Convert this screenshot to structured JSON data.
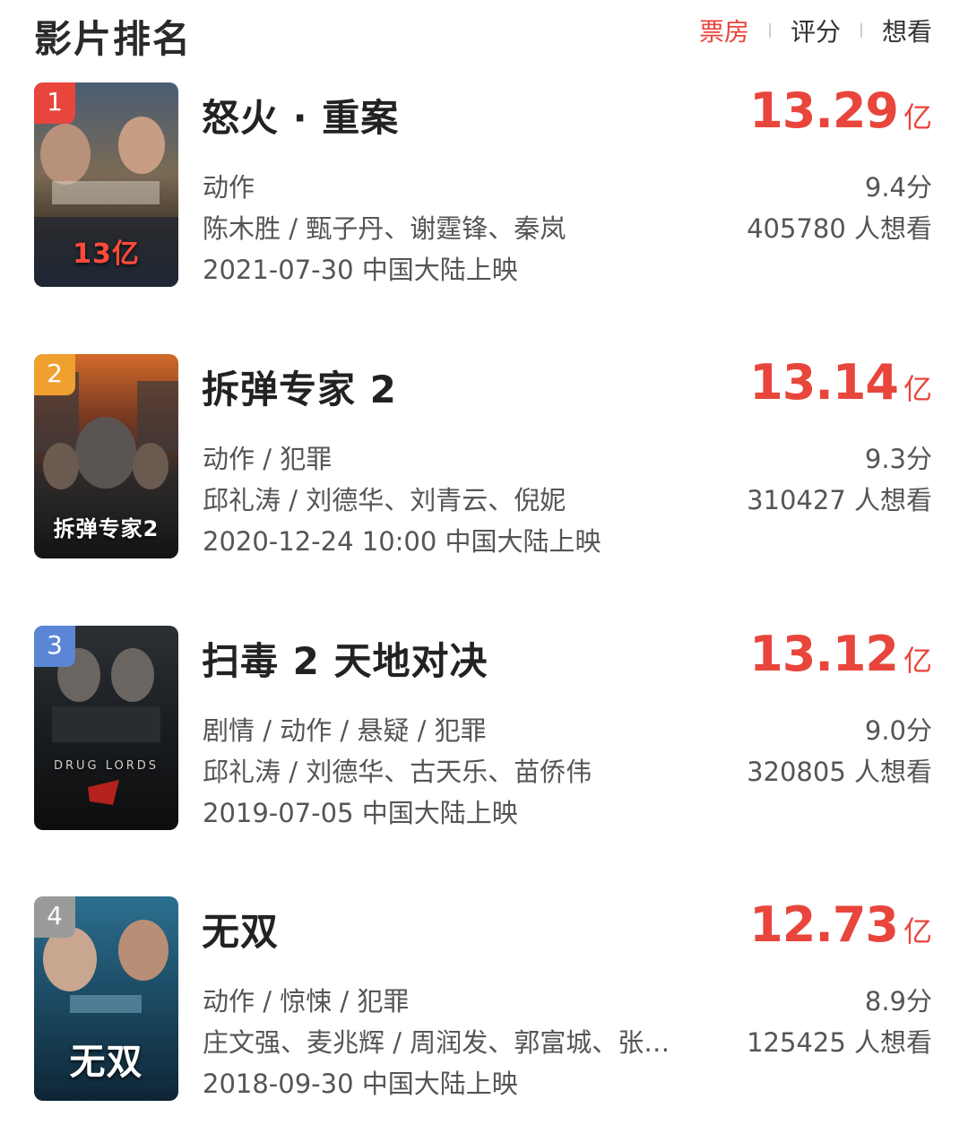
{
  "header": {
    "title": "影片排名",
    "tabs": [
      {
        "label": "票房",
        "active": true
      },
      {
        "label": "评分",
        "active": false
      },
      {
        "label": "想看",
        "active": false
      }
    ]
  },
  "colors": {
    "accent": "#e8453c",
    "rank_1": "#e8453c",
    "rank_2": "#f0a030",
    "rank_3": "#5b86d6",
    "rank_4": "#9a9a9a"
  },
  "movies": [
    {
      "rank": "1",
      "title": "怒火 · 重案",
      "boxoffice": "13.29",
      "unit": "亿",
      "genre": "动作",
      "score": "9.4分",
      "cast": "陈木胜 / 甄子丹、谢霆锋、秦岚",
      "want": "405780 人想看",
      "release": "2021-07-30 中国大陆上映",
      "poster_caption": "13亿"
    },
    {
      "rank": "2",
      "title": "拆弹专家 2",
      "boxoffice": "13.14",
      "unit": "亿",
      "genre": "动作 / 犯罪",
      "score": "9.3分",
      "cast": "邱礼涛 / 刘德华、刘青云、倪妮",
      "want": "310427 人想看",
      "release": "2020-12-24 10:00 中国大陆上映",
      "poster_caption": "拆弹专家2"
    },
    {
      "rank": "3",
      "title": "扫毒 2 天地对决",
      "boxoffice": "13.12",
      "unit": "亿",
      "genre": "剧情 / 动作 / 悬疑 / 犯罪",
      "score": "9.0分",
      "cast": "邱礼涛 / 刘德华、古天乐、苗侨伟",
      "want": "320805 人想看",
      "release": "2019-07-05 中国大陆上映",
      "poster_caption": "DRUG LORDS"
    },
    {
      "rank": "4",
      "title": "无双",
      "boxoffice": "12.73",
      "unit": "亿",
      "genre": "动作 / 惊悚 / 犯罪",
      "score": "8.9分",
      "cast": "庄文强、麦兆辉 / 周润发、郭富城、张…",
      "want": "125425 人想看",
      "release": "2018-09-30 中国大陆上映",
      "poster_caption": "无双"
    }
  ]
}
